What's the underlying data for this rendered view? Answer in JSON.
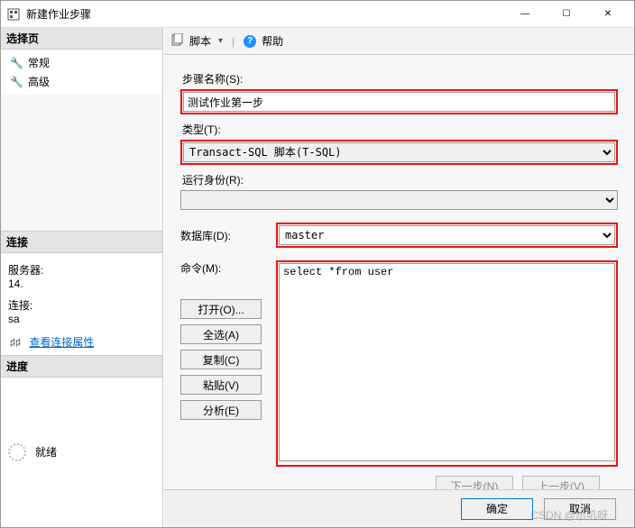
{
  "window": {
    "title": "新建作业步骤",
    "min": "—",
    "max": "☐",
    "close": "✕"
  },
  "sidebar": {
    "select_page": "选择页",
    "items": [
      {
        "label": "常规"
      },
      {
        "label": "高级"
      }
    ],
    "connection": {
      "header": "连接",
      "server_label": "服务器:",
      "server_value": "14.",
      "conn_label": "连接:",
      "conn_value": "sa",
      "view_props": "查看连接属性"
    },
    "progress": {
      "header": "进度",
      "status": "就绪"
    }
  },
  "toolbar": {
    "script": "脚本",
    "help": "帮助"
  },
  "form": {
    "step_name_label": "步骤名称(S):",
    "step_name_value": "测试作业第一步",
    "type_label": "类型(T):",
    "type_value": "Transact-SQL 脚本(T-SQL)",
    "run_as_label": "运行身份(R):",
    "run_as_value": "",
    "database_label": "数据库(D):",
    "database_value": "master",
    "command_label": "命令(M):",
    "command_value": "select *from user",
    "buttons": {
      "open": "打开(O)...",
      "select_all": "全选(A)",
      "copy": "复制(C)",
      "paste": "粘贴(V)",
      "parse": "分析(E)"
    },
    "nav": {
      "next": "下一步(N)",
      "prev": "上一步(V)"
    }
  },
  "footer": {
    "ok": "确定",
    "cancel": "取消"
  },
  "watermark": "CSDN @尔叽呀"
}
